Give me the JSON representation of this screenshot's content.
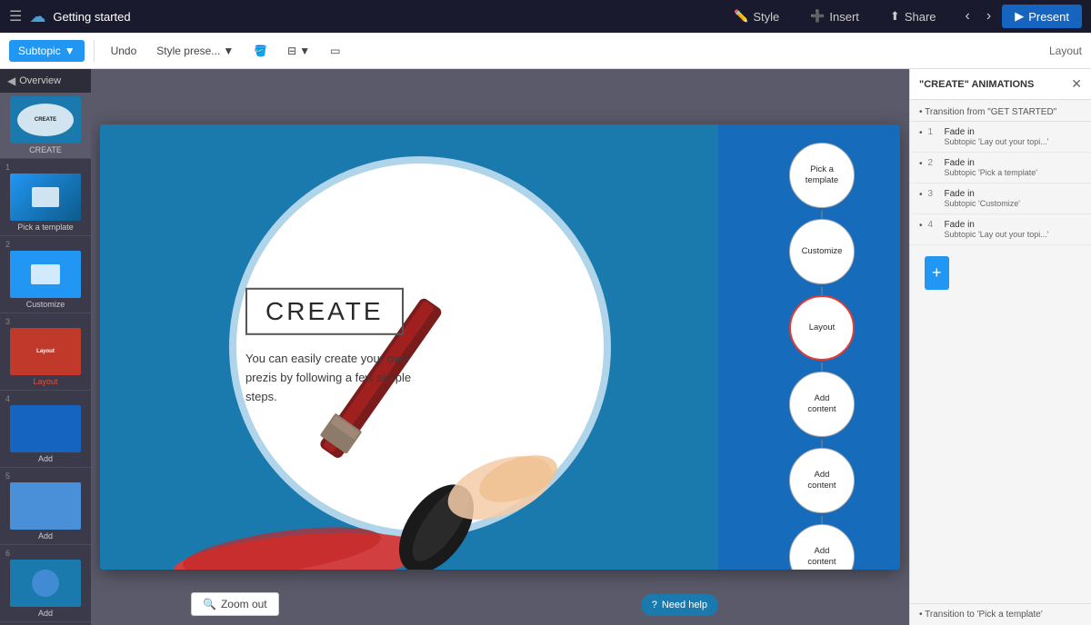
{
  "topbar": {
    "title": "Getting started",
    "style_btn": "Style",
    "insert_btn": "Insert",
    "share_btn": "Share",
    "present_btn": "Present"
  },
  "toolbar": {
    "subtopic_label": "Subtopic",
    "undo_label": "Undo",
    "style_preset_label": "Style prese...",
    "layout_label": "Layout"
  },
  "sidebar": {
    "header": "Overview",
    "slides": [
      {
        "number": "",
        "label": "CREATE",
        "type": "create"
      },
      {
        "number": "1",
        "label": "Pick a template",
        "type": "template"
      },
      {
        "number": "2",
        "label": "Customize",
        "type": "customize"
      },
      {
        "number": "3",
        "label": "Layout",
        "type": "layout"
      },
      {
        "number": "4",
        "label": "Add",
        "type": "add1"
      },
      {
        "number": "5",
        "label": "Add",
        "type": "add2"
      },
      {
        "number": "6",
        "label": "Add",
        "type": "add3"
      }
    ]
  },
  "slide": {
    "title": "CREATE",
    "subtitle": "You can easily create your own prezis by following a few simple steps.",
    "steps": [
      {
        "label": "Pick a\ntemplate",
        "active": false
      },
      {
        "label": "Customize",
        "active": false
      },
      {
        "label": "Layout",
        "active": true
      },
      {
        "label": "Add\ncontent",
        "active": false
      },
      {
        "label": "Add\ncontent",
        "active": false
      },
      {
        "label": "Add\ncontent",
        "active": false
      }
    ]
  },
  "right_panel": {
    "title": "\"CREATE\" ANIMATIONS",
    "transition_from": "Transition from \"GET STARTED\"",
    "animations": [
      {
        "number": "1",
        "type": "Fade in",
        "subtitle": "Subtopic 'Lay out your topi...'"
      },
      {
        "number": "2",
        "type": "Fade in",
        "subtitle": "Subtopic 'Pick a template'"
      },
      {
        "number": "3",
        "type": "Fade in",
        "subtitle": "Subtopic 'Customize'"
      },
      {
        "number": "4",
        "type": "Fade in",
        "subtitle": "Subtopic 'Lay out your topi...'"
      }
    ],
    "transition_to": "Transition to 'Pick a template'"
  },
  "zoom_out_btn": "Zoom out",
  "need_help_btn": "Need help"
}
